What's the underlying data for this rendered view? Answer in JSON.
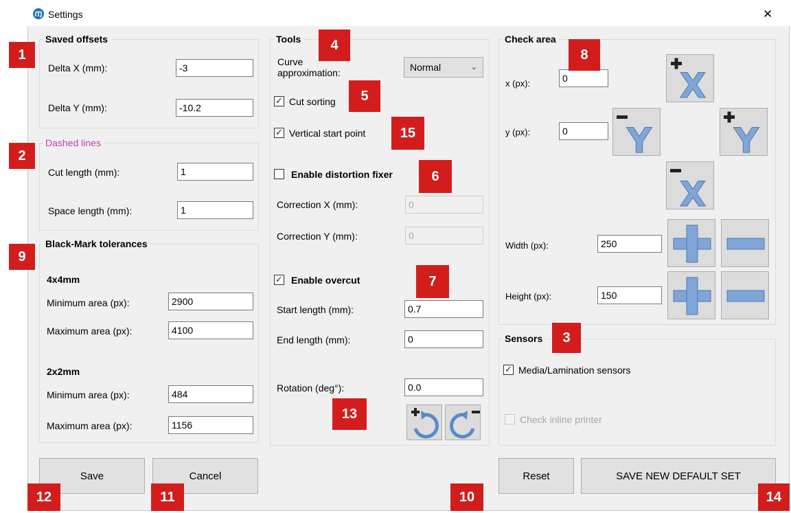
{
  "window": {
    "title": "Settings",
    "close_glyph": "✕"
  },
  "saved_offsets": {
    "legend": "Saved offsets",
    "delta_x_label": "Delta X (mm):",
    "delta_x_value": "-3",
    "delta_y_label": "Delta Y (mm):",
    "delta_y_value": "-10.2"
  },
  "dashed_lines": {
    "legend": "Dashed lines",
    "cut_length_label": "Cut length (mm):",
    "cut_length_value": "1",
    "space_length_label": "Space length (mm):",
    "space_length_value": "1"
  },
  "black_mark": {
    "legend": "Black-Mark tolerances",
    "group1_title": "4x4mm",
    "g1_min_label": "Minimum area (px):",
    "g1_min_value": "2900",
    "g1_max_label": "Maximum area (px):",
    "g1_max_value": "4100",
    "group2_title": "2x2mm",
    "g2_min_label": "Minimum area (px):",
    "g2_min_value": "484",
    "g2_max_label": "Maximum area (px):",
    "g2_max_value": "1156"
  },
  "tools": {
    "legend": "Tools",
    "curve_label_line1": "Curve",
    "curve_label_line2": "approximation:",
    "curve_value": "Normal",
    "cut_sorting_label": "Cut sorting",
    "cut_sorting_checked": true,
    "vertical_start_label": "Vertical start point",
    "vertical_start_checked": true,
    "distortion_label": "Enable distortion fixer",
    "distortion_checked": false,
    "corr_x_label": "Correction X (mm):",
    "corr_x_value": "0",
    "corr_y_label": "Correction Y (mm):",
    "corr_y_value": "0",
    "overcut_label": "Enable overcut",
    "overcut_checked": true,
    "start_length_label": "Start length (mm):",
    "start_length_value": "0.7",
    "end_length_label": "End length (mm):",
    "end_length_value": "0",
    "rotation_label": "Rotation (deg°):",
    "rotation_value": "0.0",
    "check_glyph": "✓"
  },
  "check_area": {
    "legend": "Check area",
    "x_label": "x (px):",
    "x_value": "0",
    "y_label": "y (px):",
    "y_value": "0",
    "width_label": "Width (px):",
    "width_value": "250",
    "height_label": "Height (px):",
    "height_value": "150",
    "accent_color": "#7fa6d6"
  },
  "sensors": {
    "legend": "Sensors",
    "media_label": "Media/Lamination sensors",
    "media_checked": true,
    "inline_printer_label": "Check inline printer",
    "inline_printer_checked": false
  },
  "buttons": {
    "save": "Save",
    "cancel": "Cancel",
    "reset": "Reset",
    "save_default": "SAVE NEW DEFAULT SET"
  },
  "badges": {
    "b1": "1",
    "b2": "2",
    "b3": "3",
    "b4": "4",
    "b5": "5",
    "b6": "6",
    "b7": "7",
    "b8": "8",
    "b9": "9",
    "b10": "10",
    "b11": "11",
    "b12": "12",
    "b13": "13",
    "b14": "14",
    "b15": "15",
    "color": "#d31d1d"
  }
}
